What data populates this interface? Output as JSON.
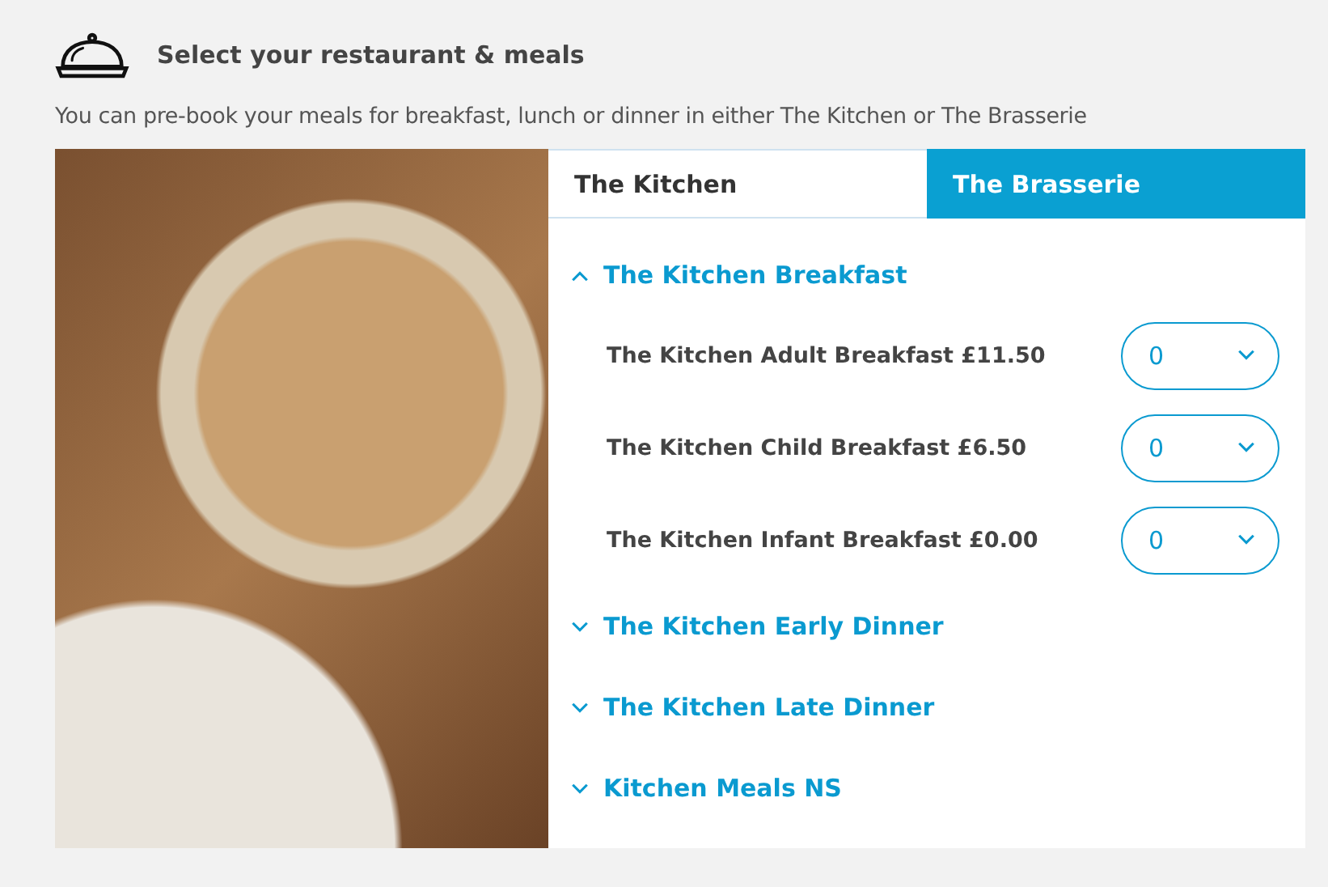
{
  "header": {
    "title": "Select your restaurant & meals",
    "description": "You can pre-book your meals for breakfast, lunch or dinner in either The Kitchen or The Brasserie"
  },
  "tabs": [
    {
      "label": "The Kitchen",
      "selected": true
    },
    {
      "label": "The Brasserie",
      "selected": false
    }
  ],
  "sections": [
    {
      "title": "The Kitchen Breakfast",
      "expanded": true,
      "items": [
        {
          "label": "The Kitchen Adult Breakfast £11.50",
          "quantity": "0"
        },
        {
          "label": "The Kitchen Child Breakfast £6.50",
          "quantity": "0"
        },
        {
          "label": "The Kitchen Infant Breakfast £0.00",
          "quantity": "0"
        }
      ]
    },
    {
      "title": "The Kitchen Early Dinner",
      "expanded": false
    },
    {
      "title": "The Kitchen Late Dinner",
      "expanded": false
    },
    {
      "title": "Kitchen Meals NS",
      "expanded": false
    }
  ]
}
